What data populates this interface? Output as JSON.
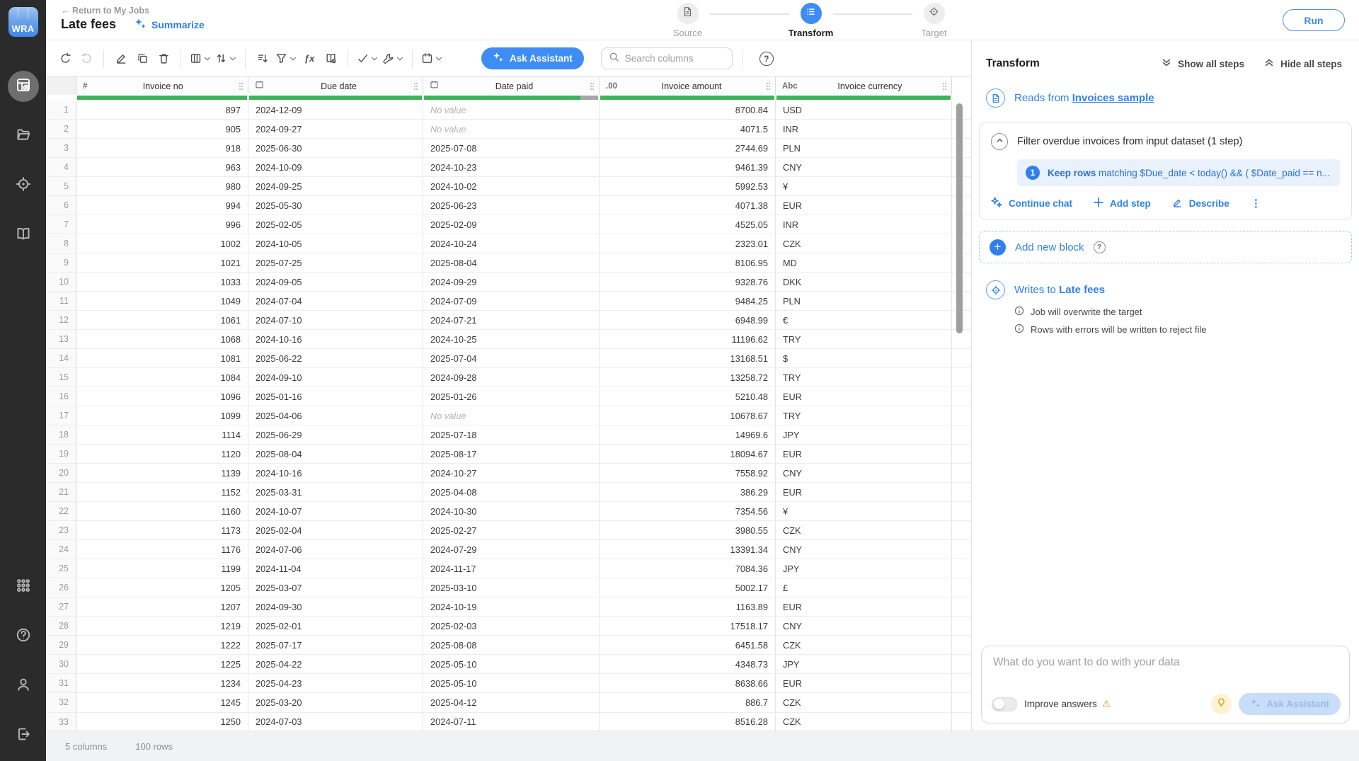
{
  "colors": {
    "accent": "#2F80ED",
    "button_blue": "#3D8DF5",
    "quality_green": "#3CB45C",
    "quality_gray": "#A6A6A6",
    "warning": "#E09B3D",
    "sidebar_bg": "#2B2B2B"
  },
  "sidebar": {
    "logo_text": "WRA"
  },
  "topbar": {
    "back_label": "Return to My Jobs",
    "title": "Late fees",
    "summarize_label": "Summarize",
    "run_label": "Run",
    "stepper": [
      {
        "label": "Source"
      },
      {
        "label": "Transform"
      },
      {
        "label": "Target"
      }
    ]
  },
  "toolbar": {
    "formula_icon": "ƒx",
    "ask_assistant_label": "Ask Assistant",
    "search_placeholder": "Search columns",
    "help_glyph": "?"
  },
  "table": {
    "columns": [
      {
        "name": "Invoice no",
        "type_label": "#",
        "quality": {
          "green": 100,
          "gray": 0
        }
      },
      {
        "name": "Due date",
        "type_label": "calendar",
        "quality": {
          "green": 100,
          "gray": 0
        }
      },
      {
        "name": "Date paid",
        "type_label": "calendar",
        "quality": {
          "green": 90,
          "gray": 10
        }
      },
      {
        "name": "Invoice amount",
        "type_label": ".00",
        "quality": {
          "green": 100,
          "gray": 0
        }
      },
      {
        "name": "Invoice currency",
        "type_label": "Abc",
        "quality": {
          "green": 100,
          "gray": 0
        }
      }
    ],
    "no_value_label": "No value",
    "rows": [
      [
        "897",
        "2024-12-09",
        null,
        "8700.84",
        "USD"
      ],
      [
        "905",
        "2024-09-27",
        null,
        "4071.5",
        "INR"
      ],
      [
        "918",
        "2025-06-30",
        "2025-07-08",
        "2744.69",
        "PLN"
      ],
      [
        "963",
        "2024-10-09",
        "2024-10-23",
        "9461.39",
        "CNY"
      ],
      [
        "980",
        "2024-09-25",
        "2024-10-02",
        "5992.53",
        "¥"
      ],
      [
        "994",
        "2025-05-30",
        "2025-06-23",
        "4071.38",
        "EUR"
      ],
      [
        "996",
        "2025-02-05",
        "2025-02-09",
        "4525.05",
        "INR"
      ],
      [
        "1002",
        "2024-10-05",
        "2024-10-24",
        "2323.01",
        "CZK"
      ],
      [
        "1021",
        "2025-07-25",
        "2025-08-04",
        "8106.95",
        "MD"
      ],
      [
        "1033",
        "2024-09-05",
        "2024-09-29",
        "9328.76",
        "DKK"
      ],
      [
        "1049",
        "2024-07-04",
        "2024-07-09",
        "9484.25",
        "PLN"
      ],
      [
        "1061",
        "2024-07-10",
        "2024-07-21",
        "6948.99",
        "€"
      ],
      [
        "1068",
        "2024-10-16",
        "2024-10-25",
        "11196.62",
        "TRY"
      ],
      [
        "1081",
        "2025-06-22",
        "2025-07-04",
        "13168.51",
        "$"
      ],
      [
        "1084",
        "2024-09-10",
        "2024-09-28",
        "13258.72",
        "TRY"
      ],
      [
        "1096",
        "2025-01-16",
        "2025-01-26",
        "5210.48",
        "EUR"
      ],
      [
        "1099",
        "2025-04-06",
        null,
        "10678.67",
        "TRY"
      ],
      [
        "1114",
        "2025-06-29",
        "2025-07-18",
        "14969.6",
        "JPY"
      ],
      [
        "1120",
        "2025-08-04",
        "2025-08-17",
        "18094.67",
        "EUR"
      ],
      [
        "1139",
        "2024-10-16",
        "2024-10-27",
        "7558.92",
        "CNY"
      ],
      [
        "1152",
        "2025-03-31",
        "2025-04-08",
        "386.29",
        "EUR"
      ],
      [
        "1160",
        "2024-10-07",
        "2024-10-30",
        "7354.56",
        "¥"
      ],
      [
        "1173",
        "2025-02-04",
        "2025-02-27",
        "3980.55",
        "CZK"
      ],
      [
        "1176",
        "2024-07-06",
        "2024-07-29",
        "13391.34",
        "CNY"
      ],
      [
        "1199",
        "2024-11-04",
        "2024-11-17",
        "7084.36",
        "JPY"
      ],
      [
        "1205",
        "2025-03-07",
        "2025-03-10",
        "5002.17",
        "£"
      ],
      [
        "1207",
        "2024-09-30",
        "2024-10-19",
        "1163.89",
        "EUR"
      ],
      [
        "1219",
        "2025-02-01",
        "2025-02-03",
        "17518.17",
        "CNY"
      ],
      [
        "1222",
        "2025-07-17",
        "2025-08-08",
        "6451.58",
        "CZK"
      ],
      [
        "1225",
        "2025-04-22",
        "2025-05-10",
        "4348.73",
        "JPY"
      ],
      [
        "1234",
        "2025-04-23",
        "2025-05-10",
        "8638.66",
        "EUR"
      ],
      [
        "1245",
        "2025-03-20",
        "2025-04-12",
        "886.7",
        "CZK"
      ],
      [
        "1250",
        "2024-07-03",
        "2024-07-11",
        "8516.28",
        "CZK"
      ]
    ]
  },
  "panel": {
    "title": "Transform",
    "show_all_label": "Show all steps",
    "hide_all_label": "Hide all steps",
    "reads": {
      "prefix": "Reads from",
      "source": "Invoices sample"
    },
    "block": {
      "title": "Filter overdue invoices from input dataset (1 step)",
      "step_number": "1",
      "step_bold": "Keep rows",
      "step_rest": " matching $Due_date < today() && ( $Date_paid == n...",
      "continue_chat_label": "Continue chat",
      "add_step_label": "Add step",
      "describe_label": "Describe"
    },
    "add_block_label": "Add new block",
    "writes": {
      "prefix": "Writes to",
      "target": "Late fees",
      "notes": [
        "Job will overwrite the target",
        "Rows with errors will be written to reject file"
      ]
    },
    "chat": {
      "placeholder": "What do you want to do with your data",
      "toggle_label": "Improve answers",
      "warning_glyph": "⚠",
      "submit_label": "Ask Assistant"
    }
  },
  "statusbar": {
    "columns_label": "5 columns",
    "rows_label": "100 rows"
  }
}
